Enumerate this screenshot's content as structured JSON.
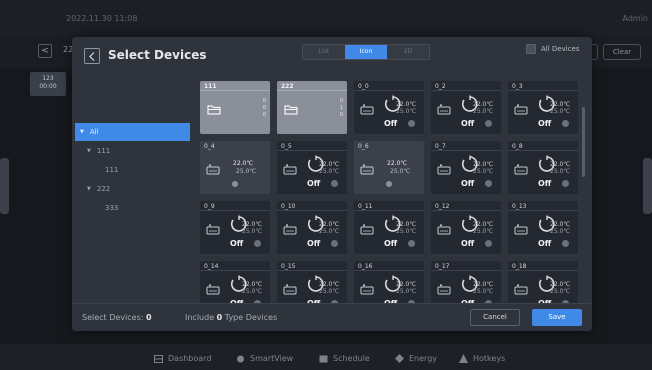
{
  "app": {
    "datetime": "2022.11.30  11:08",
    "user": "Admin",
    "bg_number": "22",
    "bg_clear": "Clear",
    "bg_tile": {
      "line1": "123",
      "line2": "00:00"
    }
  },
  "navbar": {
    "items": [
      {
        "label": "Dashboard",
        "icon": "dashboard-icon"
      },
      {
        "label": "SmartView",
        "icon": "smartview-icon"
      },
      {
        "label": "Schedule",
        "icon": "schedule-icon"
      },
      {
        "label": "Energy",
        "icon": "energy-icon"
      },
      {
        "label": "Hotkeys",
        "icon": "hotkeys-icon"
      }
    ]
  },
  "modal": {
    "title": "Select Devices",
    "view_modes": [
      "List",
      "Icon",
      "2D"
    ],
    "active_view": "Icon",
    "all_devices_label": "All Devices",
    "tree": [
      {
        "label": "All",
        "level": 0,
        "arrow": "▼",
        "selected": true
      },
      {
        "label": "111",
        "level": 1,
        "arrow": "▼"
      },
      {
        "label": "111",
        "level": 2
      },
      {
        "label": "222",
        "level": 1,
        "arrow": "▼"
      },
      {
        "label": "333",
        "level": 2
      }
    ],
    "groups": [
      {
        "name": "111",
        "values": [
          "0",
          "0",
          "0"
        ]
      },
      {
        "name": "222",
        "values": [
          "0",
          "1",
          "0"
        ]
      }
    ],
    "devices": [
      {
        "name": "0_0",
        "t1": "22.0℃",
        "t2": "25.0℃",
        "status": "Off",
        "style": "dial"
      },
      {
        "name": "0_2",
        "t1": "22.0℃",
        "t2": "25.0℃",
        "status": "Off",
        "style": "dial"
      },
      {
        "name": "0_3",
        "t1": "22.0℃",
        "t2": "25.0℃",
        "status": "Off",
        "style": "dial"
      },
      {
        "name": "0_4",
        "t1": "22.0℃",
        "t2": "25.0℃",
        "status": "",
        "style": "plain"
      },
      {
        "name": "0_5",
        "t1": "22.0℃",
        "t2": "25.0℃",
        "status": "Off",
        "style": "dial"
      },
      {
        "name": "0_6",
        "t1": "22.0℃",
        "t2": "25.0℃",
        "status": "",
        "style": "plain"
      },
      {
        "name": "0_7",
        "t1": "22.0℃",
        "t2": "25.0℃",
        "status": "Off",
        "style": "dial"
      },
      {
        "name": "0_8",
        "t1": "22.0℃",
        "t2": "25.0℃",
        "status": "Off",
        "style": "dial"
      },
      {
        "name": "0_9",
        "t1": "22.0℃",
        "t2": "25.0℃",
        "status": "Off",
        "style": "dial"
      },
      {
        "name": "0_10",
        "t1": "22.0℃",
        "t2": "25.0℃",
        "status": "Off",
        "style": "dial"
      },
      {
        "name": "0_11",
        "t1": "22.0℃",
        "t2": "25.0℃",
        "status": "Off",
        "style": "dial"
      },
      {
        "name": "0_12",
        "t1": "22.0℃",
        "t2": "25.0℃",
        "status": "Off",
        "style": "dial"
      },
      {
        "name": "0_13",
        "t1": "22.0℃",
        "t2": "25.0℃",
        "status": "Off",
        "style": "dial"
      },
      {
        "name": "0_14",
        "t1": "22.0℃",
        "t2": "25.0℃",
        "status": "Off",
        "style": "dial"
      },
      {
        "name": "0_15",
        "t1": "22.0℃",
        "t2": "25.0℃",
        "status": "Off",
        "style": "dial"
      },
      {
        "name": "0_16",
        "t1": "22.0℃",
        "t2": "25.0℃",
        "status": "Off",
        "style": "dial"
      },
      {
        "name": "0_17",
        "t1": "22.0℃",
        "t2": "25.0℃",
        "status": "Off",
        "style": "dial"
      },
      {
        "name": "0_18",
        "t1": "22.0℃",
        "t2": "25.0℃",
        "status": "Off",
        "style": "dial"
      }
    ],
    "footer": {
      "select_label": "Select Devices:",
      "select_count": "0",
      "include_label": "Include",
      "include_count": "0",
      "type_label": "Type Devices",
      "cancel": "Cancel",
      "save": "Save"
    },
    "colors": {
      "accent": "#3f8ae6",
      "panel": "#2f333b",
      "card": "#242830"
    }
  }
}
